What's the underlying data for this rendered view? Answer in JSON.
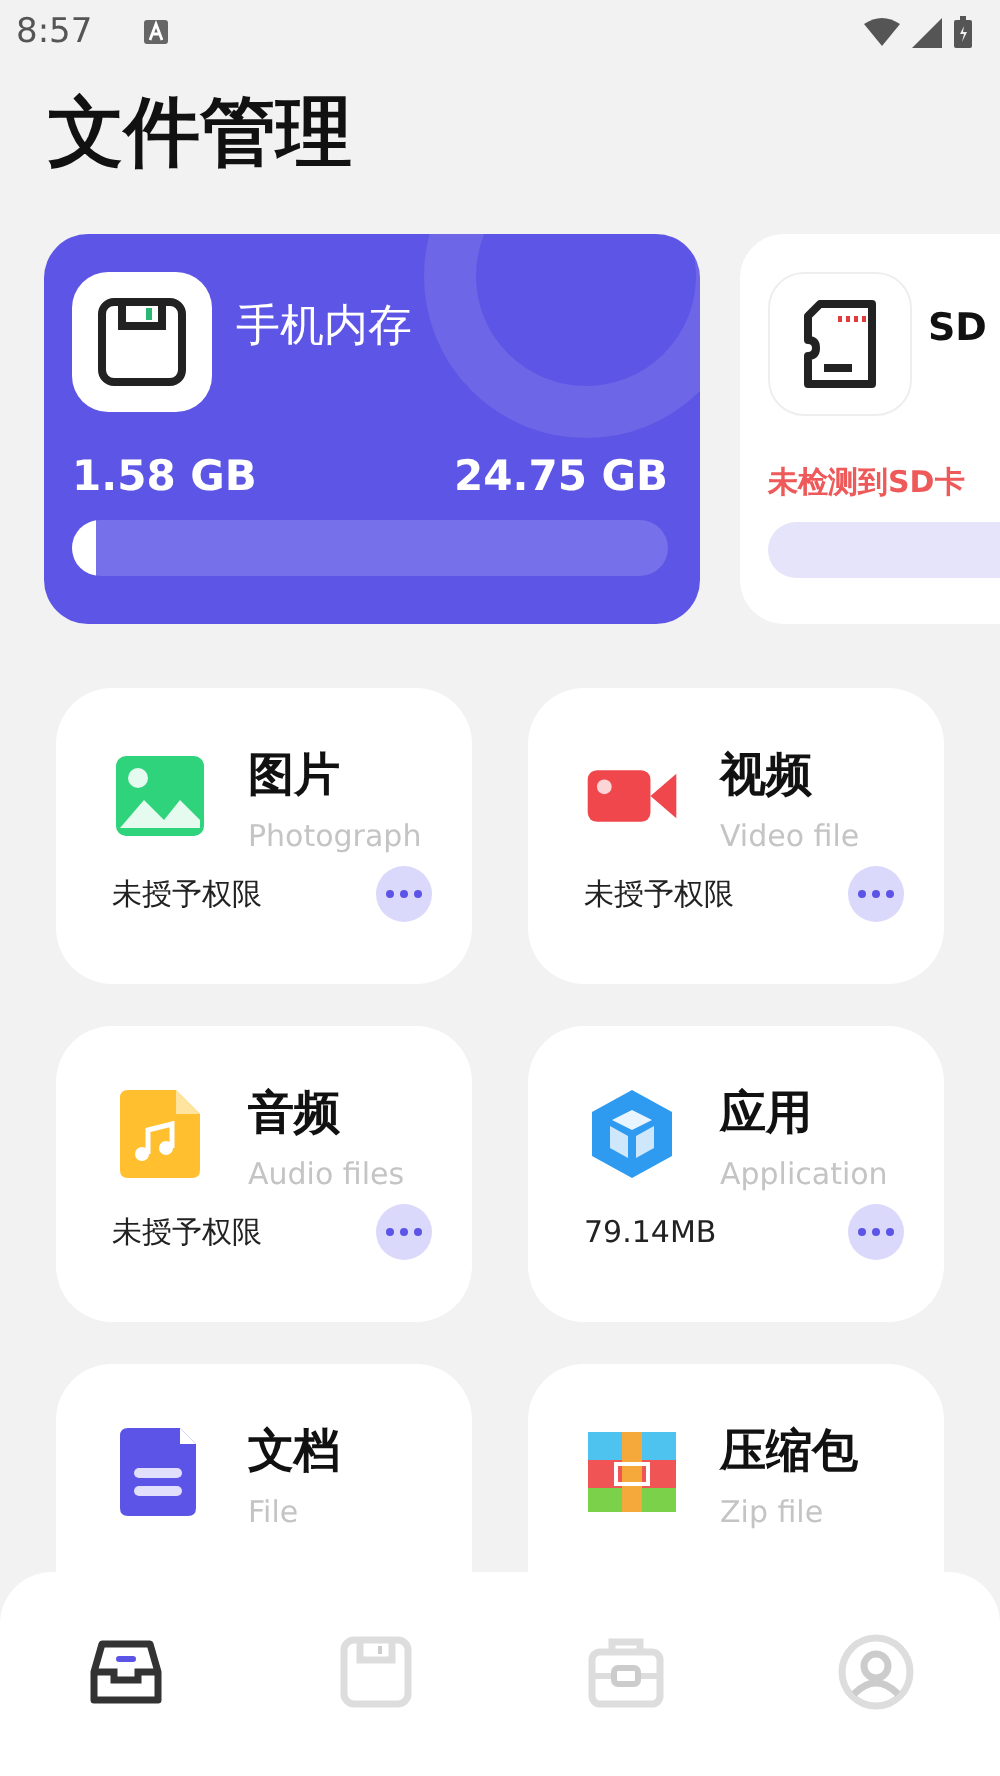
{
  "status_bar": {
    "time": "8:57"
  },
  "title": "文件管理",
  "storage": [
    {
      "kind": "phone",
      "name": "手机内存",
      "used": "1.58 GB",
      "total": "24.75 GB",
      "level": 0.04
    },
    {
      "kind": "sd",
      "name": "SD",
      "message": "未检测到SD卡"
    }
  ],
  "categories": [
    {
      "kind": "image",
      "title": "图片",
      "subtitle": "Photograph",
      "status": "未授予权限"
    },
    {
      "kind": "video",
      "title": "视频",
      "subtitle": "Video file",
      "status": "未授予权限"
    },
    {
      "kind": "audio",
      "title": "音频",
      "subtitle": "Audio files",
      "status": "未授予权限"
    },
    {
      "kind": "app",
      "title": "应用",
      "subtitle": "Application",
      "status": "79.14MB"
    },
    {
      "kind": "doc",
      "title": "文档",
      "subtitle": "File"
    },
    {
      "kind": "zip",
      "title": "压缩包",
      "subtitle": "Zip file"
    }
  ],
  "bottom_nav": [
    {
      "kind": "inbox",
      "selected": true
    },
    {
      "kind": "storage",
      "selected": false
    },
    {
      "kind": "toolbox",
      "selected": false
    },
    {
      "kind": "profile",
      "selected": false
    }
  ]
}
